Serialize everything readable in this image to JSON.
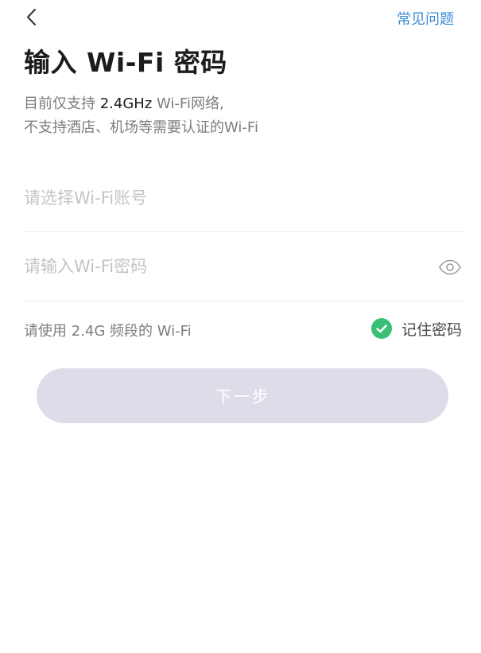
{
  "header": {
    "back_icon": "chevron-left-icon",
    "faq_label": "常见问题",
    "accent_color": "#3a8ad3"
  },
  "title": "输入 Wi-Fi 密码",
  "subtitle": {
    "line1_prefix": "目前仅支持 ",
    "line1_highlight": "2.4GHz",
    "line1_suffix": " Wi-Fi网络,",
    "line2": "不支持酒店、机场等需要认证的Wi-Fi"
  },
  "ssid_field": {
    "placeholder": "请选择Wi-Fi账号",
    "value": ""
  },
  "password_field": {
    "placeholder": "请输入Wi-Fi密码",
    "value": "",
    "toggle_icon": "eye-icon"
  },
  "band_hint": "请使用 2.4G 频段的 Wi-Fi",
  "remember": {
    "label": "记住密码",
    "checked": true,
    "check_color": "#3bbf77",
    "icon": "check-circle-icon"
  },
  "next_button": {
    "label": "下一步",
    "background": "#dcdde8"
  }
}
